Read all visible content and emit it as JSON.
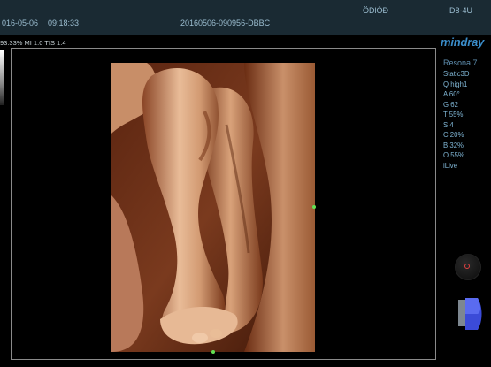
{
  "header": {
    "date": "016-05-06",
    "time": "09:18:33",
    "study_id": "20160506-090956-DBBC",
    "hospital": "ÖDlÓÐ",
    "probe": "D8-4U"
  },
  "ticker": {
    "line": "93.33%  MI 1.0  TIS 1.4"
  },
  "sidebar": {
    "logo": "mindray",
    "model": "Resona 7",
    "params": [
      "Static3D",
      "Q high1",
      "A 60°",
      "G 62",
      "T 55%",
      "S 4",
      "C 20%",
      "B 32%",
      "O 55%",
      "iLive"
    ]
  },
  "colors": {
    "accent": "#3a8cc8",
    "top_bar": "#1a2a33",
    "marker": "#63e053",
    "render_shadow": "#4a1a08",
    "render_highlight": "#f0c9a8"
  },
  "icons": {
    "knob": "trackball-knob-icon",
    "orientation": "3d-orientation-icon"
  }
}
